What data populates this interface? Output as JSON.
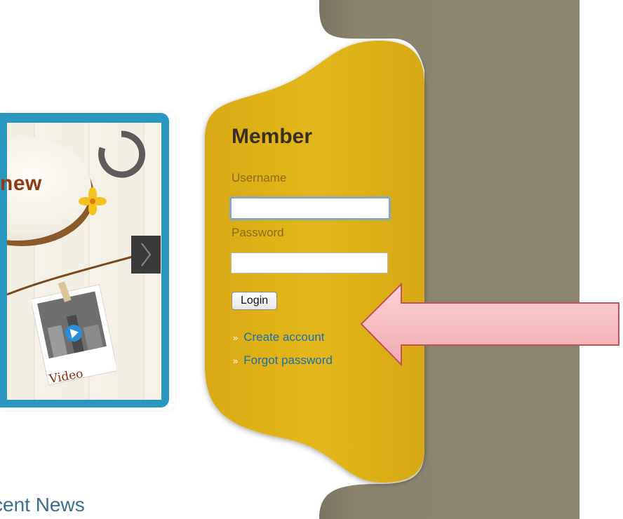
{
  "panel": {
    "title": "Member",
    "username_label": "Username",
    "username_value": "",
    "password_label": "Password",
    "password_value": "",
    "login_label": "Login",
    "links": [
      {
        "label": "Create account"
      },
      {
        "label": "Forgot password"
      }
    ]
  },
  "slider": {
    "badge_text": "new",
    "photo_caption": "Video"
  },
  "section": {
    "heading": "cent News"
  },
  "colors": {
    "panel_yellow": "#e2b418",
    "sidebar_olive": "#8b8570",
    "slider_blue": "#2a97c0",
    "link_blue": "#1a6fb3",
    "callout_pink": "#f6b7bd"
  }
}
